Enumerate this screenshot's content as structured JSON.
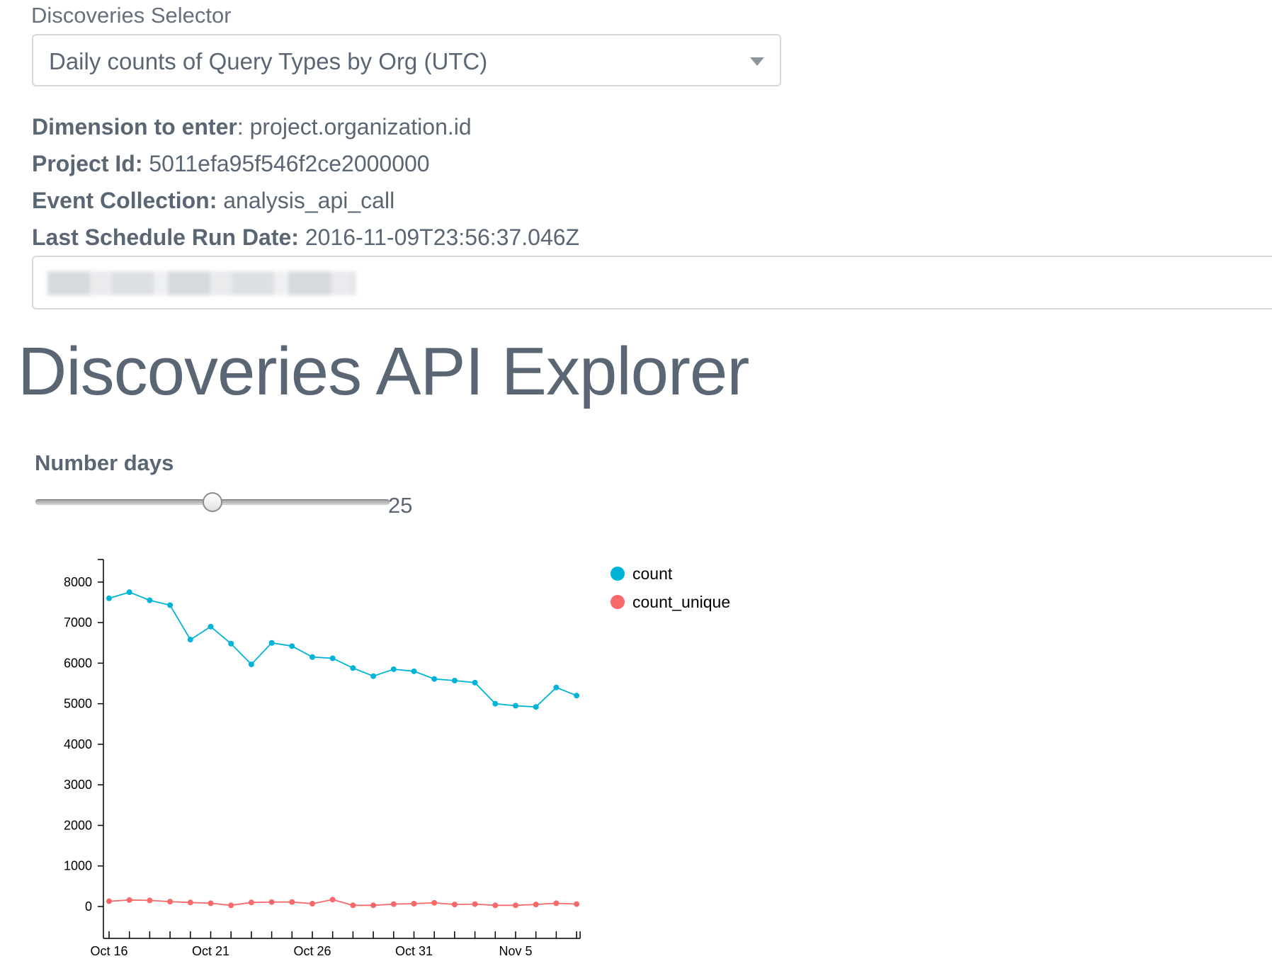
{
  "selector": {
    "label": "Discoveries Selector",
    "value": "Daily counts of Query Types by Org (UTC)"
  },
  "info": {
    "dimension_label": "Dimension to enter",
    "dimension_value": ": project.organization.id",
    "project_label": "Project Id:",
    "project_value": " 5011efa95f546f2ce2000000",
    "collection_label": "Event Collection:",
    "collection_value": " analysis_api_call",
    "date_label": "Last Schedule Run Date:",
    "date_value": " 2016-11-09T23:56:37.046Z"
  },
  "page_title": "Discoveries API Explorer",
  "slider": {
    "label": "Number days",
    "value": "25",
    "fraction": 0.5
  },
  "chart_data": {
    "type": "line",
    "x": [
      "2016-10-16",
      "2016-10-17",
      "2016-10-18",
      "2016-10-19",
      "2016-10-20",
      "2016-10-21",
      "2016-10-22",
      "2016-10-23",
      "2016-10-24",
      "2016-10-25",
      "2016-10-26",
      "2016-10-27",
      "2016-10-28",
      "2016-10-29",
      "2016-10-30",
      "2016-10-31",
      "2016-11-01",
      "2016-11-02",
      "2016-11-03",
      "2016-11-04",
      "2016-11-05",
      "2016-11-06",
      "2016-11-07",
      "2016-11-08"
    ],
    "x_tick_labels": [
      "Oct 16",
      "Oct 21",
      "Oct 26",
      "Oct 31",
      "Nov 5"
    ],
    "series": [
      {
        "name": "count",
        "color": "#00b4d8",
        "values": [
          7600,
          7750,
          7550,
          7430,
          6580,
          6900,
          6480,
          5970,
          6500,
          6420,
          6150,
          6120,
          5880,
          5680,
          5850,
          5800,
          5610,
          5570,
          5520,
          5000,
          4950,
          4920,
          5400,
          5200
        ]
      },
      {
        "name": "count_unique",
        "color": "#f8696b",
        "values": [
          130,
          160,
          150,
          120,
          100,
          80,
          30,
          100,
          110,
          110,
          70,
          170,
          30,
          30,
          60,
          70,
          90,
          50,
          60,
          30,
          30,
          50,
          80,
          60
        ]
      }
    ],
    "y_ticks": [
      "0",
      "1000",
      "2000",
      "3000",
      "4000",
      "5000",
      "6000",
      "7000",
      "8000"
    ],
    "ylim": [
      -750,
      8550
    ],
    "legend": "top-right"
  }
}
